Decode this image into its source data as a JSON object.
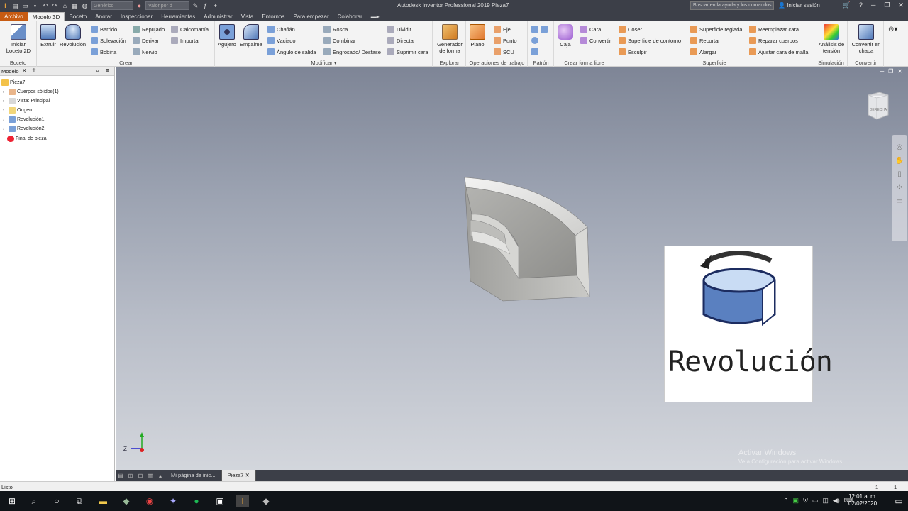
{
  "window": {
    "title": "Autodesk Inventor Professional 2019    Pieza7",
    "help_search_placeholder": "Buscar en la ayuda y los comandos",
    "signin": "Iniciar sesión",
    "material": "Genérico",
    "appearance": "Valor por d"
  },
  "tabs": [
    "Archivo",
    "Modelo 3D",
    "Boceto",
    "Anotar",
    "Inspeccionar",
    "Herramientas",
    "Administrar",
    "Vista",
    "Entornos",
    "Para empezar",
    "Colaborar"
  ],
  "ribbon": {
    "boceto": {
      "title": "Boceto",
      "start": "Iniciar boceto 2D"
    },
    "crear": {
      "title": "Crear",
      "extruir": "Extruir",
      "revolucion": "Revolución",
      "barrido": "Barrido",
      "solevacion": "Solevación",
      "bobina": "Bobina",
      "repujado": "Repujado",
      "derivar": "Derivar",
      "nervio": "Nervio",
      "calcomania": "Calcomanía",
      "importar": "Importar"
    },
    "modificar": {
      "title": "Modificar",
      "agujero": "Agujero",
      "empalme": "Empalme",
      "chaflan": "Chaflán",
      "vaciado": "Vaciado",
      "angulo": "Ángulo de salida",
      "rosca": "Rosca",
      "combinar": "Combinar",
      "engrosado": "Engrosado/ Desfase",
      "dividir": "Dividir",
      "directa": "Directa",
      "suprimir": "Suprimir cara"
    },
    "explorar": {
      "title": "Explorar",
      "generador": "Generador de forma"
    },
    "operaciones": {
      "title": "Operaciones de trabajo",
      "plano": "Plano",
      "eje": "Eje",
      "punto": "Punto",
      "scu": "SCU"
    },
    "patron": {
      "title": "Patrón"
    },
    "forma_libre": {
      "title": "Crear forma libre",
      "caja": "Caja",
      "cara": "Cara",
      "convertir": "Convertir"
    },
    "superficie": {
      "title": "Superficie",
      "coser": "Coser",
      "contorno": "Superficie de contorno",
      "esculpir": "Esculpir",
      "reglada": "Superficie reglada",
      "recortar": "Recortar",
      "alargar": "Alargar",
      "reemplazar": "Reemplazar cara",
      "reparar": "Reparar cuerpos",
      "ajustar": "Ajustar cara de malla"
    },
    "simulacion": {
      "title": "Simulación",
      "analisis": "Análisis de tensión"
    },
    "convertir": {
      "title": "Convertir",
      "chapa": "Convertir en chapa"
    }
  },
  "browser": {
    "tab": "Modelo",
    "items": [
      "Pieza7",
      "Cuerpos sólidos(1)",
      "Vista: Principal",
      "Origen",
      "Revolución1",
      "Revolución2",
      "Final de pieza"
    ]
  },
  "viewcube_label": "DERECHA",
  "overlay_label": "Revolución",
  "axis": {
    "z": "Z"
  },
  "watermark": {
    "line1": "Activar Windows",
    "line2": "Ve a Configuración para activar Windows."
  },
  "doc_tabs": [
    "Mi página de inic...",
    "Pieza7"
  ],
  "status": {
    "text": "Listo",
    "num1": "1",
    "num2": "1"
  },
  "clock": {
    "time": "12:01 a. m.",
    "date": "02/02/2020"
  },
  "colors": {
    "titlebar": "#3c3f48",
    "file_tab": "#c75b12",
    "ribbon": "#f3f3f3"
  }
}
